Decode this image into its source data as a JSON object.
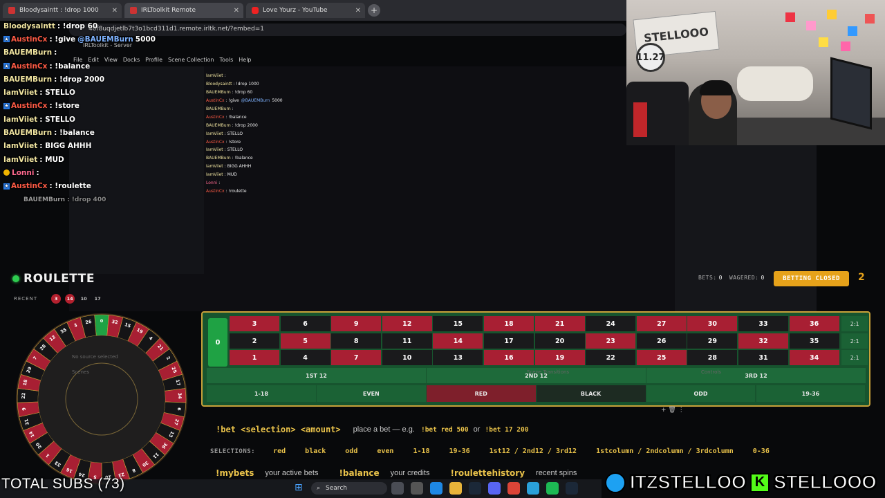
{
  "browser": {
    "tabs": [
      {
        "label": "Bloodysaintt : !drop 1000",
        "icon": "twitch-icon"
      },
      {
        "label": "IRLToolkit Remote",
        "icon": "irltoolkit-icon"
      },
      {
        "label": "Love Yourz - YouTube",
        "icon": "youtube-icon"
      }
    ],
    "url": "40f8uqdjetlb7t3o1bcd311d1.remote.irltk.net/?embed=1",
    "subbar": "IRLToolkit - Server"
  },
  "obs_menu": [
    "File",
    "Edit",
    "View",
    "Docks",
    "Profile",
    "Scene Collection",
    "Tools",
    "Help"
  ],
  "chat": [
    {
      "user": "Bloodysaintt",
      "text": ": !drop 60",
      "color": "default"
    },
    {
      "user": "AustinCx",
      "text": ": !give",
      "mention": "@BAUEMBurn",
      "tail": "5000",
      "color": "red",
      "badge": true
    },
    {
      "user": "BAUEMBurn",
      "text": ":",
      "color": "default"
    },
    {
      "user": "AustinCx",
      "text": ": !balance",
      "color": "red",
      "badge": true
    },
    {
      "user": "BAUEMBurn",
      "text": ": !drop 2000",
      "color": "default"
    },
    {
      "user": "IamViiet",
      "text": ": STELLO",
      "color": "default"
    },
    {
      "user": "AustinCx",
      "text": ": !store",
      "color": "red",
      "badge": true
    },
    {
      "user": "IamViiet",
      "text": ": STELLO",
      "color": "default"
    },
    {
      "user": "BAUEMBurn",
      "text": ": !balance",
      "color": "default"
    },
    {
      "user": "IamViiet",
      "text": ": BIGG AHHH",
      "color": "default"
    },
    {
      "user": "IamViiet",
      "text": ": MUD",
      "color": "default"
    },
    {
      "user": "Lonni",
      "text": ":",
      "color": "pink",
      "badge2": true
    },
    {
      "user": "AustinCx",
      "text": ": !roulette",
      "color": "red",
      "badge": true
    }
  ],
  "chat_faded": {
    "user": "BAUEMBurn",
    "text": ": !drop 400"
  },
  "minichat": [
    {
      "user": "IamViiet",
      "text": ":",
      "color": "default"
    },
    {
      "user": "Bloodysaintt",
      "text": ": !drop 1000",
      "color": "default"
    },
    {
      "user": "BAUEMBurn",
      "text": ": !drop 60",
      "color": "default"
    },
    {
      "user": "AustinCx",
      "text": ": !give",
      "mention": "@BAUEMBurn",
      "tail": "5000",
      "color": "red"
    },
    {
      "user": "BAUEMBurn",
      "text": ":",
      "color": "default"
    },
    {
      "user": "AustinCx",
      "text": ": !balance",
      "color": "red"
    },
    {
      "user": "BAUEMBurn",
      "text": ": !drop 2000",
      "color": "default"
    },
    {
      "user": "IamViiet",
      "text": ": STELLO",
      "color": "default"
    },
    {
      "user": "AustinCx",
      "text": ": !store",
      "color": "red"
    },
    {
      "user": "IamViiet",
      "text": ": STELLO",
      "color": "default"
    },
    {
      "user": "BAUEMBurn",
      "text": ": !balance",
      "color": "default"
    },
    {
      "user": "IamViiet",
      "text": ": BIGG AHHH",
      "color": "default"
    },
    {
      "user": "IamViiet",
      "text": ": MUD",
      "color": "default"
    },
    {
      "user": "Lonni",
      "text": ":",
      "color": "pink"
    },
    {
      "user": "AustinCx",
      "text": ": !roulette",
      "color": "red"
    }
  ],
  "webcam": {
    "banner": "STELLOOO",
    "poster": "11.27"
  },
  "roulette": {
    "title": "ROULETTE",
    "recent_label": "RECENT",
    "recent": [
      {
        "n": "3",
        "c": "red"
      },
      {
        "n": "14",
        "c": "red"
      },
      {
        "n": "10",
        "c": "black"
      },
      {
        "n": "17",
        "c": "black"
      }
    ],
    "bets_label": "BETS:",
    "bets": "0",
    "wagered_label": "WAGERED:",
    "wagered": "0",
    "status": "BETTING CLOSED",
    "countdown": "2",
    "wheel_order": [
      "0",
      "32",
      "15",
      "19",
      "4",
      "21",
      "2",
      "25",
      "17",
      "34",
      "6",
      "27",
      "13",
      "36",
      "11",
      "30",
      "8",
      "23",
      "10",
      "5",
      "24",
      "16",
      "33",
      "1",
      "20",
      "14",
      "31",
      "9",
      "22",
      "18",
      "29",
      "7",
      "28",
      "12",
      "35",
      "3",
      "26"
    ],
    "red_numbers": [
      1,
      3,
      5,
      7,
      9,
      12,
      14,
      16,
      18,
      19,
      21,
      23,
      25,
      27,
      30,
      32,
      34,
      36
    ],
    "zero": "0",
    "rows": [
      [
        "3",
        "6",
        "9",
        "12",
        "15",
        "18",
        "21",
        "24",
        "27",
        "30",
        "33",
        "36"
      ],
      [
        "2",
        "5",
        "8",
        "11",
        "14",
        "17",
        "20",
        "23",
        "26",
        "29",
        "32",
        "35"
      ],
      [
        "1",
        "4",
        "7",
        "10",
        "13",
        "16",
        "19",
        "22",
        "25",
        "28",
        "31",
        "34"
      ]
    ],
    "column_label": "2:1",
    "dozens": [
      "1ST 12",
      "2ND 12",
      "3RD 12"
    ],
    "outside": [
      "1-18",
      "EVEN",
      "RED",
      "BLACK",
      "ODD",
      "19-36"
    ]
  },
  "help": {
    "bet_cmd": "!bet <selection> <amount>",
    "bet_desc": "place a bet — e.g.",
    "ex1": "!bet red 500",
    "or": "or",
    "ex2": "!bet 17 200",
    "selections_label": "SELECTIONS:",
    "selections": [
      "red",
      "black",
      "odd",
      "even",
      "1-18",
      "19-36",
      "1st12 / 2nd12 / 3rd12",
      "1stcolumn / 2ndcolumn / 3rdcolumn",
      "0-36"
    ],
    "cmds": [
      {
        "cmd": "!mybets",
        "desc": "your active bets"
      },
      {
        "cmd": "!balance",
        "desc": "your credits"
      },
      {
        "cmd": "!roulettehistory",
        "desc": "recent spins"
      }
    ]
  },
  "taskbar": {
    "search": "Search"
  },
  "overlay": {
    "subs": "TOTAL SUBS (73)",
    "twitter": "ITZSTELLOO",
    "kick": "STELLOOO"
  },
  "colors": {
    "red": "#a81f33",
    "black": "#1a1a1c",
    "green": "#1fa244",
    "felt": "#17542e",
    "gold": "#e6a21a",
    "accent": "#e9c24a"
  }
}
